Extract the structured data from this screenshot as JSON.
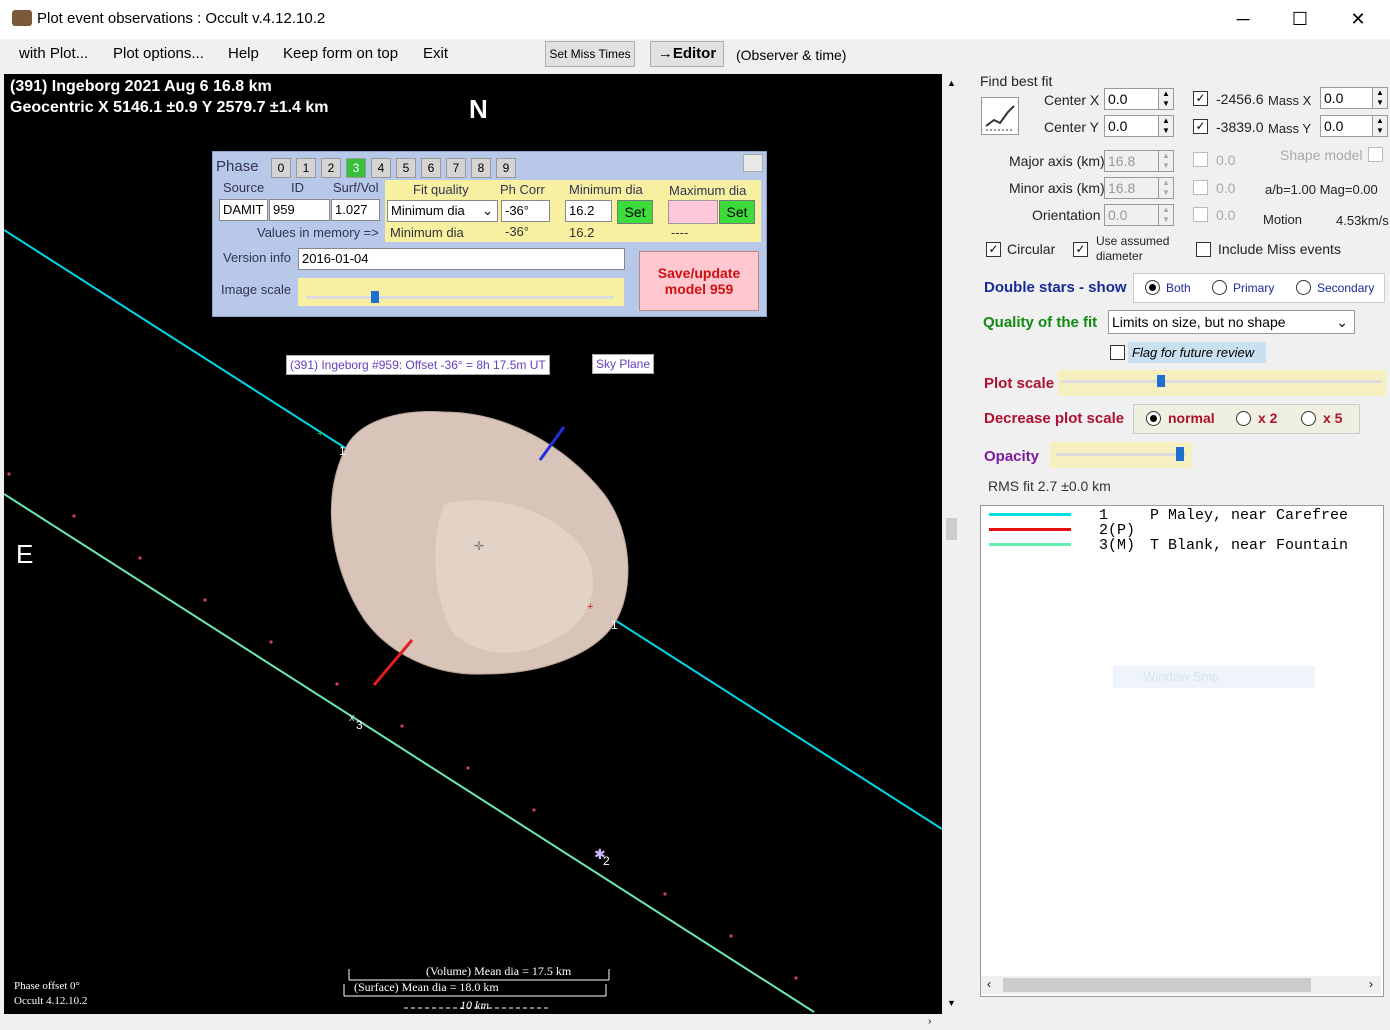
{
  "window": {
    "title": "Plot event observations : Occult v.4.12.10.2",
    "min": "─",
    "max": "☐",
    "close": "✕"
  },
  "menu": {
    "items": [
      "with Plot...",
      "Plot options...",
      "Help",
      "Keep form on top",
      "Exit"
    ],
    "set_miss_times": "Set Miss Times",
    "editor": "→Editor",
    "observer_time": "(Observer & time)"
  },
  "plot": {
    "line1": "(391) Ingeborg  2021 Aug 6   16.8 km",
    "line2": "Geocentric X 5146.1 ±0.9  Y 2579.7 ±1.4 km",
    "north": "N",
    "east": "E",
    "chord_labels": [
      "1",
      "1",
      "3",
      "2"
    ],
    "model_title": "(391) Ingeborg #959: Offset -36° = 8h 17.5m UT",
    "sky_plane": "Sky Plane",
    "volume_dia": "(Volume) Mean dia = 17.5 km",
    "surface_dia": "(Surface) Mean dia = 18.0 km",
    "scale_label": "10 km",
    "phase_offset": "Phase offset 0°",
    "version": "Occult 4.12.10.2"
  },
  "phase_panel": {
    "phase_label": "Phase",
    "phases": [
      "0",
      "1",
      "2",
      "3",
      "4",
      "5",
      "6",
      "7",
      "8",
      "9"
    ],
    "selected_phase": "3",
    "source_label": "Source",
    "id_label": "ID",
    "surfvol_label": "Surf/Vol",
    "source": "DAMIT",
    "id": "959",
    "surfvol": "1.027",
    "fit_quality_label": "Fit quality",
    "ph_corr_label": "Ph Corr",
    "min_dia_label": "Minimum dia",
    "max_dia_label": "Maximum dia",
    "fit_quality": "Minimum dia",
    "ph_corr": "-36°",
    "min_dia": "16.2",
    "set_label": "Set",
    "values_in_memory": "Values in memory =>",
    "mem_fit_quality": "Minimum dia",
    "mem_ph_corr": "-36°",
    "mem_min_dia": "16.2",
    "mem_max_dia": "----",
    "version_info_label": "Version info",
    "version_info": "2016-01-04",
    "image_scale_label": "Image scale",
    "save_update": "Save/update model 959"
  },
  "right": {
    "find_best_fit": "Find best fit",
    "center_x_label": "Center X",
    "center_x": "0.0",
    "center_y_label": "Center Y",
    "center_y": "0.0",
    "fit_x": "-2456.6",
    "fit_y": "-3839.0",
    "mass_x_label": "Mass X",
    "mass_x": "0.0",
    "mass_y_label": "Mass Y",
    "mass_y": "0.0",
    "major_label": "Major axis (km)",
    "major": "16.8",
    "major_err": "0.0",
    "minor_label": "Minor axis (km)",
    "minor": "16.8",
    "minor_err": "0.0",
    "orient_label": "Orientation",
    "orient": "0.0",
    "orient_err": "0.0",
    "shape_model": "Shape model",
    "ab_mag": "a/b=1.00  Mag=0.00",
    "motion_label": "Motion",
    "motion": "4.53km/s",
    "circular": "Circular",
    "use_assumed": "Use assumed diameter",
    "include_miss": "Include Miss events",
    "double_stars": "Double stars - show",
    "ds_options": [
      "Both",
      "Primary",
      "Secondary"
    ],
    "quality_label": "Quality of the fit",
    "quality_value": "Limits on size, but no shape",
    "flag_review": "Flag for future review",
    "plot_scale": "Plot scale",
    "decrease_scale": "Decrease plot scale",
    "dec_options": [
      "normal",
      "x 2",
      "x 5"
    ],
    "opacity": "Opacity",
    "rms": "RMS fit 2.7 ±0.0 km",
    "ghost": "Window Snip"
  },
  "legend": {
    "rows": [
      {
        "num": "1",
        "name": "P Maley, near Carefree",
        "color": "#00e0e8"
      },
      {
        "num": "2(P)",
        "name": "",
        "color": "#e01010"
      },
      {
        "num": "3(M)",
        "name": "T Blank, near Fountain",
        "color": "#60f0b0"
      }
    ]
  },
  "colors": {
    "chord1": "#00d8e8",
    "chord3": "#6ee8b0",
    "body": "#d8c4b8",
    "pink_dot": "#d04060"
  }
}
